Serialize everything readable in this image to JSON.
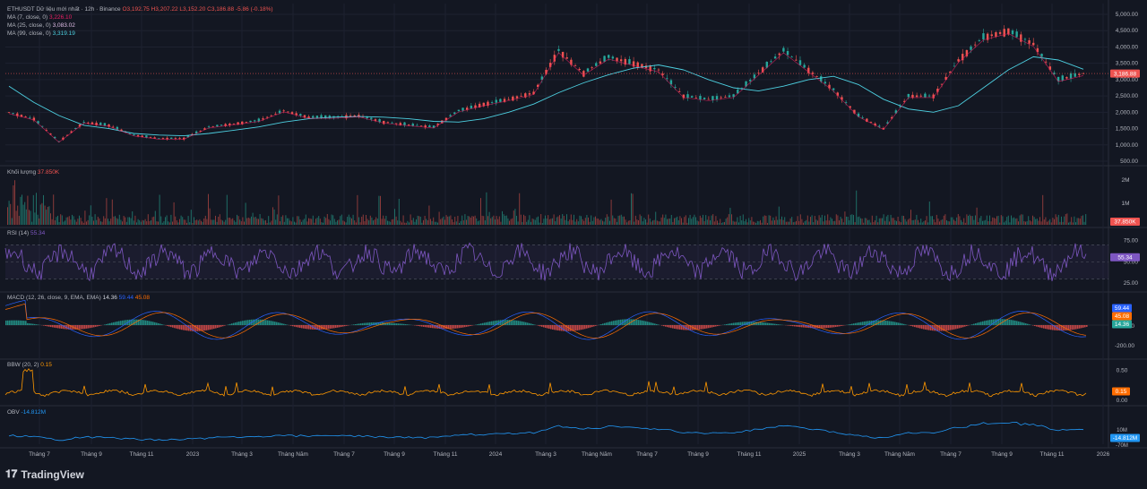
{
  "header": {
    "symbol": "ETHUSDT Dữ liệu mới nhất · 12h · Binance",
    "open": "O3,192.75",
    "high": "H3,207.22",
    "low": "L3,152.20",
    "close": "C3,186.88",
    "change": "-5.86 (-0.18%)"
  },
  "ma_legend": [
    {
      "label": "MA (7, close, 0)",
      "value": "3,226.10",
      "color": "#e91e63"
    },
    {
      "label": "MA (25, close, 0)",
      "value": "3,083.02",
      "color": "#e1bee7"
    },
    {
      "label": "MA (99, close, 0)",
      "value": "3,319.19",
      "color": "#4dd0e1"
    }
  ],
  "volume_legend": {
    "label": "Khối lượng",
    "value": "37.850K"
  },
  "rsi_legend": {
    "label": "RSI (14)",
    "value": "55.34"
  },
  "macd_legend": {
    "label": "MACD (12, 26, close, 9, EMA, EMA)",
    "v1": "14.36",
    "v2": "59.44",
    "v3": "45.08"
  },
  "bbw_legend": {
    "label": "BBW (20, 2)",
    "value": "0.15"
  },
  "obv_legend": {
    "label": "OBV",
    "value": "-14.812M"
  },
  "colors": {
    "up": "#26a69a",
    "down": "#ef5350",
    "rsi": "#7e57c2",
    "macd": "#2962ff",
    "signal": "#ff6d00",
    "bbw": "#ff9800",
    "obv": "#2196f3",
    "ma7": "#e91e63",
    "ma25": "#e1bee7",
    "ma99": "#4dd0e1"
  },
  "brand": "TradingView",
  "chart_data": [
    {
      "type": "line",
      "title": "ETHUSDT 12h · Binance",
      "y_ticks": [
        "5,000.00",
        "4,500.00",
        "4,000.00",
        "3,500.00",
        "3,000.00",
        "2,500.00",
        "2,000.00",
        "1,500.00",
        "1,000.00",
        "500.00"
      ],
      "ylim": [
        500,
        5000
      ],
      "last_price_label": "3,186.88",
      "x_ticks": [
        "Tháng 7",
        "Tháng 9",
        "Tháng 11",
        "2023",
        "Tháng 3",
        "Tháng Năm",
        "Tháng 7",
        "Tháng 9",
        "Tháng 11",
        "2024",
        "Tháng 3",
        "Tháng Năm",
        "Tháng 7",
        "Tháng 9",
        "Tháng 11",
        "2025",
        "Tháng 3",
        "Tháng Năm",
        "Tháng 7",
        "Tháng 9",
        "Tháng 11",
        "2026"
      ],
      "series": [
        {
          "name": "ETHUSDT",
          "x": [
            "2022-05",
            "2022-06",
            "2022-07",
            "2022-08",
            "2022-09",
            "2022-10",
            "2022-11",
            "2022-12",
            "2023-01",
            "2023-02",
            "2023-03",
            "2023-04",
            "2023-05",
            "2023-06",
            "2023-07",
            "2023-08",
            "2023-09",
            "2023-10",
            "2023-11",
            "2023-12",
            "2024-01",
            "2024-02",
            "2024-03",
            "2024-04",
            "2024-05",
            "2024-06",
            "2024-07",
            "2024-08",
            "2024-09",
            "2024-10",
            "2024-11",
            "2024-12",
            "2025-01",
            "2025-02",
            "2025-03",
            "2025-04",
            "2025-05",
            "2025-06",
            "2025-07",
            "2025-08",
            "2025-09",
            "2025-10",
            "2025-11",
            "2025-12"
          ],
          "values": [
            2000,
            1800,
            1100,
            1700,
            1600,
            1300,
            1200,
            1200,
            1550,
            1650,
            1750,
            2050,
            1850,
            1850,
            1900,
            1700,
            1620,
            1550,
            2050,
            2250,
            2400,
            2600,
            3900,
            3200,
            3700,
            3500,
            3300,
            2500,
            2400,
            2500,
            3200,
            3900,
            3300,
            2700,
            1900,
            1500,
            2500,
            2500,
            3600,
            4300,
            4500,
            4100,
            3000,
            3186.88
          ]
        },
        {
          "name": "MA (99, close, 0)",
          "values": [
            2800,
            2300,
            1900,
            1600,
            1500,
            1350,
            1300,
            1280,
            1350,
            1450,
            1550,
            1700,
            1800,
            1850,
            1870,
            1850,
            1800,
            1720,
            1700,
            1800,
            2000,
            2250,
            2600,
            2900,
            3150,
            3350,
            3450,
            3300,
            3000,
            2750,
            2650,
            2800,
            3000,
            3100,
            2850,
            2400,
            2100,
            2000,
            2200,
            2750,
            3300,
            3700,
            3600,
            3319.19
          ]
        }
      ]
    },
    {
      "type": "bar",
      "title": "Khối lượng",
      "y_ticks": [
        "2M",
        "1M"
      ],
      "last_value_label": "37.850K"
    },
    {
      "type": "line",
      "title": "RSI (14)",
      "y_ticks": [
        "75.00",
        "50.00",
        "25.00"
      ],
      "ylim": [
        20,
        85
      ],
      "bands": [
        70,
        30
      ],
      "last_value_label": "55.34"
    },
    {
      "type": "line",
      "title": "MACD (12, 26, close, 9, EMA, EMA)",
      "y_ticks": [
        "0",
        "-200.00"
      ],
      "last_value_labels": [
        "59.44",
        "45.08",
        "14.36"
      ]
    },
    {
      "type": "area",
      "title": "BBW (20, 2)",
      "y_ticks": [
        "0.50",
        "0.15",
        "0.00"
      ],
      "last_value_label": "0.15"
    },
    {
      "type": "line",
      "title": "OBV",
      "y_ticks": [
        "10M",
        "-14.812M",
        "-70M"
      ],
      "last_value_label": "-14.812M"
    }
  ]
}
